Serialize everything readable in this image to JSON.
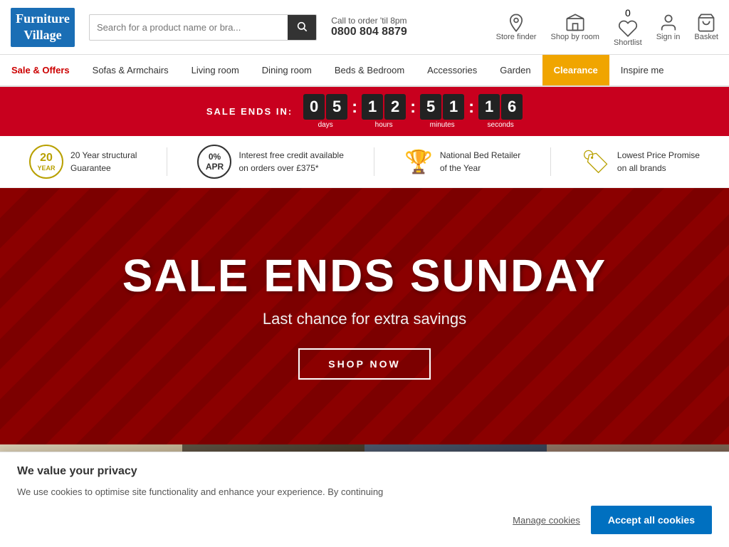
{
  "header": {
    "logo_line1": "Furniture",
    "logo_line2": "Village",
    "search_placeholder": "Search for a product name or bra...",
    "call_text": "Call to order 'til 8pm",
    "phone": "0800 804 8879",
    "nav_icons": [
      {
        "id": "store-finder",
        "label": "Store finder",
        "icon": "📍"
      },
      {
        "id": "shop-by-room",
        "label": "Shop by room",
        "icon": "🏠"
      },
      {
        "id": "shortlist",
        "label": "Shortlist",
        "icon": "♡",
        "badge": "0"
      },
      {
        "id": "sign-in",
        "label": "Sign in",
        "icon": "👤"
      },
      {
        "id": "basket",
        "label": "Basket",
        "icon": "🛒"
      }
    ]
  },
  "nav": {
    "items": [
      {
        "id": "sale",
        "label": "Sale & Offers",
        "class": "sale"
      },
      {
        "id": "sofas",
        "label": "Sofas & Armchairs",
        "class": ""
      },
      {
        "id": "living",
        "label": "Living room",
        "class": ""
      },
      {
        "id": "dining",
        "label": "Dining room",
        "class": ""
      },
      {
        "id": "beds",
        "label": "Beds & Bedroom",
        "class": ""
      },
      {
        "id": "accessories",
        "label": "Accessories",
        "class": ""
      },
      {
        "id": "garden",
        "label": "Garden",
        "class": ""
      },
      {
        "id": "clearance",
        "label": "Clearance",
        "class": "clearance"
      },
      {
        "id": "inspire",
        "label": "Inspire me",
        "class": ""
      }
    ]
  },
  "sale_bar": {
    "label": "SALE ENDS IN:",
    "countdown": [
      {
        "id": "days",
        "digits": [
          "0",
          "5"
        ],
        "unit": "days"
      },
      {
        "id": "hours",
        "digits": [
          "1",
          "2"
        ],
        "unit": "hours"
      },
      {
        "id": "minutes",
        "digits": [
          "5",
          "1"
        ],
        "unit": "minutes"
      },
      {
        "id": "seconds",
        "digits": [
          "1",
          "6"
        ],
        "unit": "seconds"
      }
    ]
  },
  "trust_bar": {
    "items": [
      {
        "id": "guarantee",
        "badge_line1": "20",
        "badge_line2": "YEAR",
        "text_line1": "20 Year structural",
        "text_line2": "Guarantee"
      },
      {
        "id": "credit",
        "badge_text": "0% APR",
        "text_line1": "Interest free credit available",
        "text_line2": "on orders over £375*"
      },
      {
        "id": "retailer",
        "text_line1": "National Bed Retailer",
        "text_line2": "of the Year"
      },
      {
        "id": "price",
        "text_line1": "Lowest Price Promise",
        "text_line2": "on all brands"
      }
    ]
  },
  "hero": {
    "title": "SALE ENDS SUNDAY",
    "subtitle": "Last chance for extra savings",
    "button_label": "SHOP NOW"
  },
  "cookie": {
    "title": "We value your privacy",
    "text": "We use cookies to optimise site functionality and enhance your experience. By continuing",
    "manage_label": "Manage cookies",
    "accept_label": "Accept all cookies"
  }
}
